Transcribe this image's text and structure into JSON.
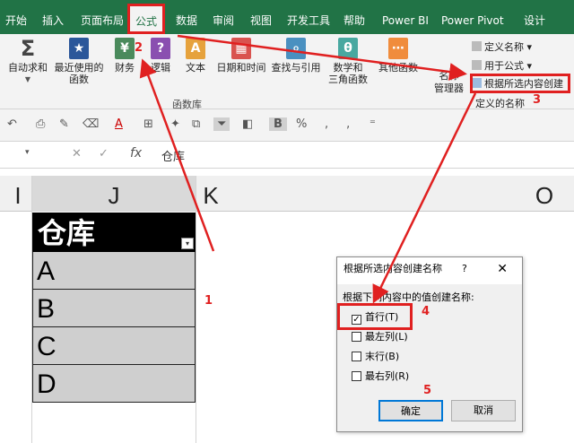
{
  "tabs": [
    "开始",
    "插入",
    "页面布局",
    "公式",
    "数据",
    "审阅",
    "视图",
    "开发工具",
    "帮助",
    "Power BI",
    "Power Pivot",
    "设计"
  ],
  "ribbon": {
    "autosum": "自动求和",
    "recent_1": "最近使用的",
    "recent_2": "函数",
    "finance": "财务",
    "logic": "逻辑",
    "text": "文本",
    "datetime": "日期和时间",
    "lookup": "查找与引用",
    "math_1": "数学和",
    "math_2": "三角函数",
    "other": "其他函数",
    "group_label": "函数库",
    "name_mgr_1": "名称",
    "name_mgr_2": "管理器",
    "define_name": "定义名称",
    "use_in_formula": "用于公式",
    "create_from_selection": "根据所选内容创建",
    "defined_names_group": "定义的名称"
  },
  "formula_bar": {
    "fx": "fx",
    "value": "仓库"
  },
  "columns": [
    "I",
    "J",
    "K",
    "O"
  ],
  "table": {
    "header": "仓库",
    "rows": [
      "A",
      "B",
      "C",
      "D"
    ]
  },
  "dialog": {
    "title": "根据所选内容创建名称",
    "help": "?",
    "close": "✕",
    "prompt": "根据下列内容中的值创建名称:",
    "options": [
      {
        "label": "首行(T)",
        "checked": true
      },
      {
        "label": "最左列(L)",
        "checked": false
      },
      {
        "label": "末行(B)",
        "checked": false
      },
      {
        "label": "最右列(R)",
        "checked": false
      }
    ],
    "ok": "确定",
    "cancel": "取消"
  },
  "annotations": [
    "1",
    "2",
    "3",
    "4",
    "5"
  ],
  "colors": {
    "excel_green": "#217346",
    "annotation_red": "#e02020"
  }
}
